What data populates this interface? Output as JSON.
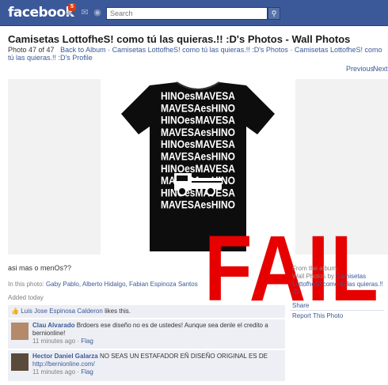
{
  "topbar": {
    "logo": "facebook",
    "notification_count": "5",
    "search_placeholder": "Search"
  },
  "page": {
    "title": "Camisetas LottofheS! como tú las quieras.!! :D's Photos - Wall Photos",
    "photo_counter": "Photo 47 of 47",
    "back_link": "Back to Album · Camisetas LottofheS! como tú las quieras.!! :D's Photos · Camisetas LottofheS! como tú las quieras.!!",
    "profile_link": ":D's Profile",
    "previous": "Previous",
    "next": "Next"
  },
  "photo": {
    "shirt_lines": [
      "HINOesMAVESA",
      "MAVESAesHINO",
      "HINOesMAVESA",
      "MAVESAesHINO",
      "HINOesMAVESA",
      "MAVESAesHINO",
      "HINOesMAVESA",
      "MAVESAesHINO",
      "HINOesMAVESA",
      "MAVESAesHINO"
    ],
    "overlay": "FAIL"
  },
  "caption": "asi mas o menOs??",
  "tags": {
    "label": "In this photo:",
    "people": "Gaby Pablo, Alberto Hidalgo, Fabian Espinoza Santos"
  },
  "added": "Added today",
  "likes": {
    "name": "Luis Jose Espinosa Calderon",
    "text": "likes this."
  },
  "comments": [
    {
      "author": "Clau Alvarado",
      "text": "Brdoers ese diseño no es de ustedes! Aunque sea denle el credito a bernionline!",
      "time": "11 minutes ago",
      "flag": "Flag"
    },
    {
      "author": "Hector Daniel Galarza",
      "text": "NO SEAS UN ESTAFADOR EÑ DISEÑO ORIGINAL ES DE",
      "link": "http://bernionline.com/",
      "time": "11 minutes ago",
      "flag": "Flag"
    }
  ],
  "sidebar": {
    "from_label": "From the album:",
    "album_prefix": "Wall Photos by",
    "album_owner": "Camisetas LottofheS! como tú las quieras.!! :D",
    "share": "Share",
    "report": "Report This Photo"
  },
  "colors": {
    "brand_blue": "#3b5998",
    "fail_red": "#e60000"
  }
}
